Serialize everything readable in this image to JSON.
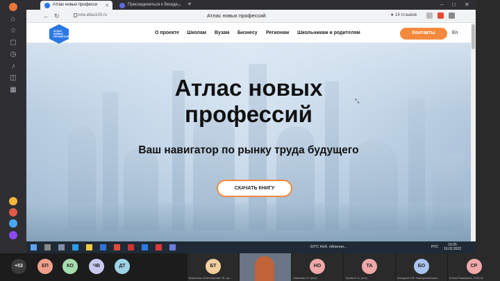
{
  "browser": {
    "tabs": [
      {
        "label": "Атлас новых професси",
        "active": true
      },
      {
        "label": "Присоединиться к беседе",
        "active": false
      }
    ],
    "url": "new.atlas100.ru",
    "page_title": "Атлас новых профессий",
    "reviews": "★ 14 отзывов"
  },
  "site": {
    "logo_text": [
      "АТЛАС",
      "НОВЫХ",
      "ПРОФЕССИЙ"
    ],
    "menu": [
      "О проекте",
      "Школам",
      "Вузам",
      "Бизнесу",
      "Регионам",
      "Школьникам и родителям"
    ],
    "contacts_label": "Контакты",
    "lang": "En",
    "hero_title_line1": "Атлас новых",
    "hero_title_line2": "профессий",
    "hero_subtitle": "Ваш навигатор по рынку труда будущего",
    "download_label": "СКАЧАТЬ КНИГУ"
  },
  "taskbar": {
    "weather": "-10°C  Ноб. облачно...",
    "lang": "РУС",
    "time": "15:25",
    "date": "16.02.2022"
  },
  "participants": {
    "more": "+53",
    "avatars": [
      {
        "initials": "ЕП",
        "color": "#f0a08a"
      },
      {
        "initials": "КО",
        "color": "#a6dcae"
      },
      {
        "initials": "ЧВ",
        "color": "#c9c9f0"
      },
      {
        "initials": "ДТ",
        "color": "#9fd3e6"
      }
    ],
    "tiles": [
      {
        "initials": "БТ",
        "color": "#f3cfa0",
        "caption": "Воронская ООШ Бортова Т.В. (пс..."
      },
      {
        "initials": "НО",
        "color": "#f0a8a8",
        "caption": "Новикова О.Н (пол)"
      },
      {
        "initials": "ТА",
        "color": "#f0a8a8",
        "caption": "Тулова Н. А. (пол)"
      },
      {
        "initials": "БО",
        "color": "#a9c4ef",
        "caption": "Баходина Н.В. Новотроиненская..."
      },
      {
        "initials": "СР",
        "color": "#f0a8a8",
        "caption": "Елена Ромашкина, СОШ 31"
      }
    ]
  },
  "colors": {
    "accent": "#f6893c",
    "logo": "#2b78e4"
  }
}
